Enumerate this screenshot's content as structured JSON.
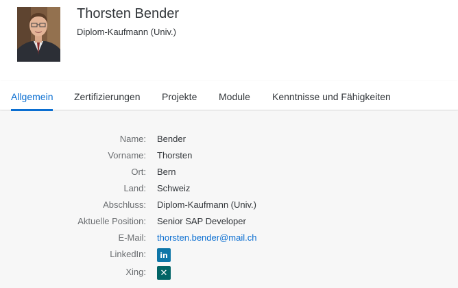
{
  "profile": {
    "name": "Thorsten Bender",
    "subtitle": "Diplom-Kaufmann (Univ.)"
  },
  "tabs": [
    {
      "label": "Allgemein",
      "active": true
    },
    {
      "label": "Zertifizierungen",
      "active": false
    },
    {
      "label": "Projekte",
      "active": false
    },
    {
      "label": "Module",
      "active": false
    },
    {
      "label": "Kenntnisse und Fähigkeiten",
      "active": false
    }
  ],
  "details": {
    "name_label": "Name:",
    "name_value": "Bender",
    "vorname_label": "Vorname:",
    "vorname_value": "Thorsten",
    "ort_label": "Ort:",
    "ort_value": "Bern",
    "land_label": "Land:",
    "land_value": "Schweiz",
    "abschluss_label": "Abschluss:",
    "abschluss_value": "Diplom-Kaufmann (Univ.)",
    "position_label": "Aktuelle Position:",
    "position_value": "Senior SAP Developer",
    "email_label": "E-Mail:",
    "email_value": "thorsten.bender@mail.ch",
    "linkedin_label": "LinkedIn:",
    "xing_label": "Xing:"
  },
  "icons": {
    "linkedin": "linkedin-icon",
    "xing": "xing-icon"
  },
  "colors": {
    "accent": "#0a6ed1",
    "linkedin": "#0e76a8",
    "xing": "#026466",
    "content_bg": "#f7f7f7"
  }
}
